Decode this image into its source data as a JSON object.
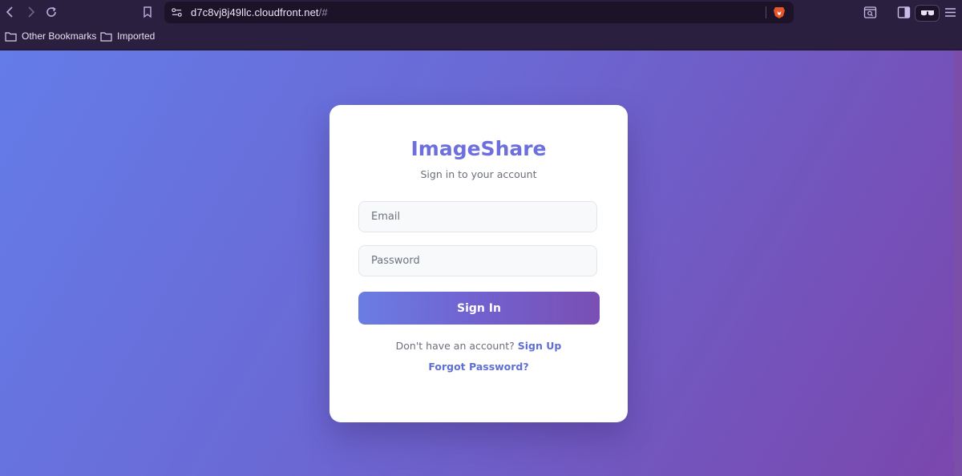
{
  "browser": {
    "url_host": "d7c8vj8j49llc.cloudfront.net",
    "url_suffix": "/#",
    "bookmarks": [
      {
        "label": "Other Bookmarks"
      },
      {
        "label": "Imported"
      }
    ],
    "icons": {
      "back": "chevron-left-icon",
      "forward": "chevron-right-icon",
      "reload": "reload-icon",
      "bookmark": "bookmark-icon",
      "site_settings": "site-settings-icon",
      "brave_shields": "brave-lion-icon",
      "search_in_page": "page-search-icon",
      "sidebar": "sidebar-icon",
      "private_glasses": "glasses-icon",
      "menu": "hamburger-menu-icon"
    }
  },
  "login": {
    "title": "ImageShare",
    "subtitle": "Sign in to your account",
    "email": {
      "placeholder": "Email",
      "value": ""
    },
    "password": {
      "placeholder": "Password",
      "value": ""
    },
    "submit_label": "Sign In",
    "signup_prompt": "Don't have an account?",
    "signup_link": "Sign Up",
    "forgot_link": "Forgot Password?"
  },
  "colors": {
    "brand": "#6c6fdc",
    "link": "#5f6fd6",
    "gradient_start": "#647ce8",
    "gradient_end": "#7a47ad"
  }
}
